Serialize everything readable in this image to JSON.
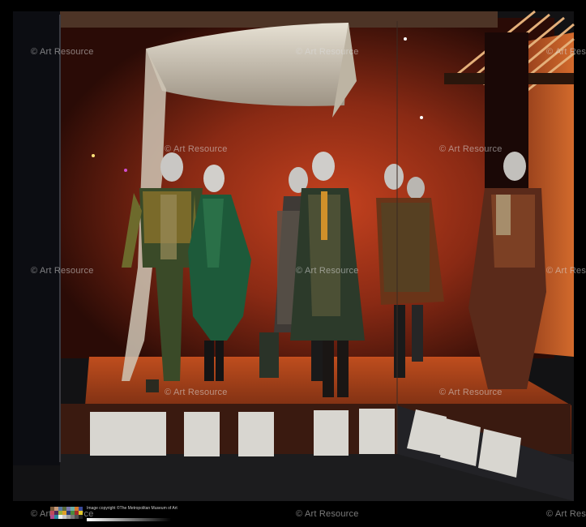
{
  "watermark": {
    "text": "© Art Resource"
  },
  "caption": {
    "text": "Image copyright ©The Metropolitan Museum of Art"
  },
  "colors": {
    "case_red": "#a8321a",
    "case_dark": "#2a0c08",
    "floor": "#1a1a1c",
    "drape": "#d9d3c4"
  }
}
